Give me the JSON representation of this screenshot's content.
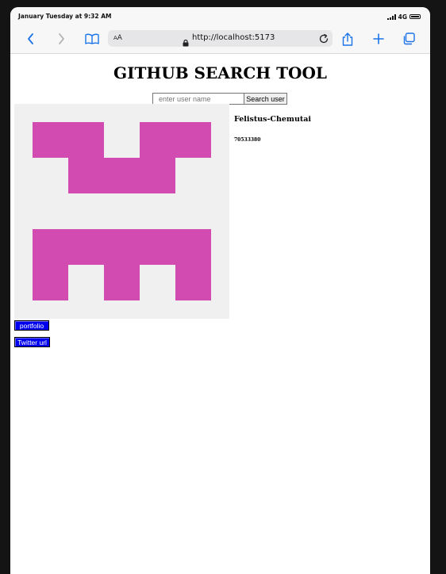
{
  "status_bar": {
    "time": "January Tuesday at 9:32 AM",
    "network": "4G"
  },
  "toolbar": {
    "text_size_label": "AA",
    "url": "http://localhost:5173",
    "icons": [
      "back-icon",
      "forward-icon",
      "bookmarks-icon",
      "lock-icon",
      "reload-icon",
      "share-icon",
      "new-tab-icon",
      "tabs-icon"
    ]
  },
  "page": {
    "title": "GITHUB SEARCH TOOL",
    "search": {
      "placeholder": "enter user name",
      "value": "",
      "button_label": "Search user"
    },
    "user": {
      "name": "Felistus-Chemutai",
      "id": "70533380",
      "avatar_color": "#d24bb1",
      "avatar_bg": "#f0f0f0"
    },
    "links": {
      "portfolio_label": "portfolio",
      "twitter_label": "Twitter url"
    }
  }
}
